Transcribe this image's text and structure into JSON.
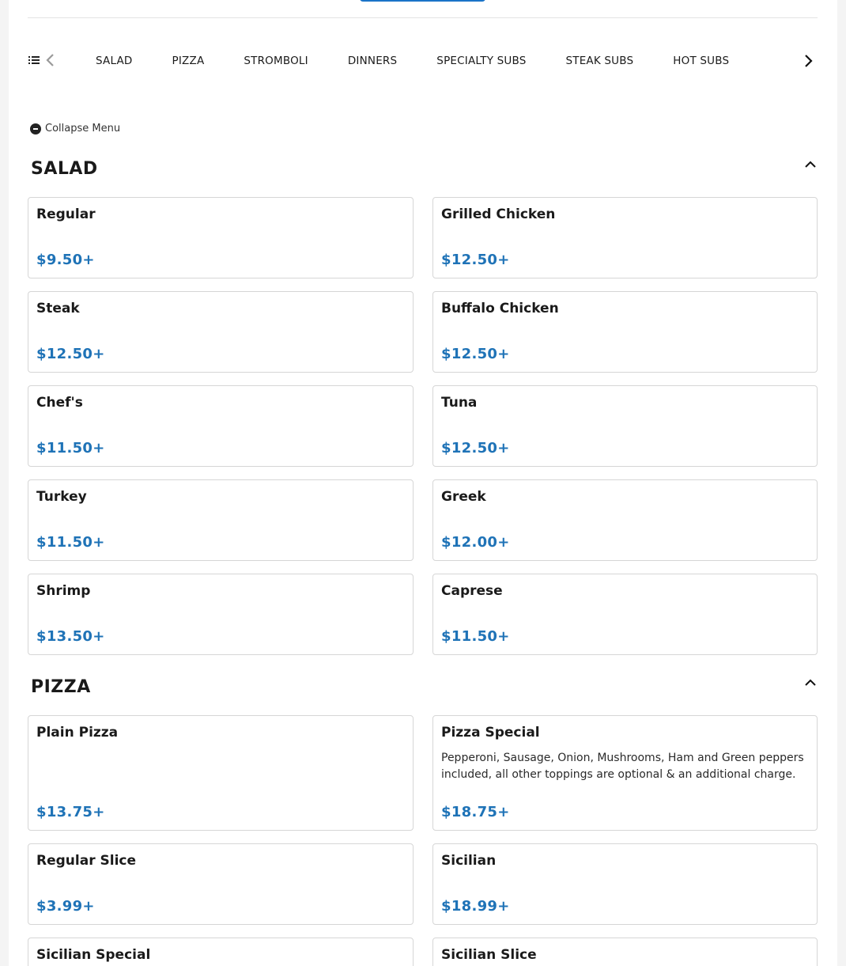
{
  "nav": {
    "categories": [
      "SALAD",
      "PIZZA",
      "STROMBOLI",
      "DINNERS",
      "SPECIALTY SUBS",
      "STEAK SUBS",
      "HOT SUBS"
    ]
  },
  "collapse_label": "Collapse Menu",
  "sections": [
    {
      "title": "SALAD",
      "items": [
        {
          "name": "Regular",
          "price": "$9.50+"
        },
        {
          "name": "Grilled Chicken",
          "price": "$12.50+"
        },
        {
          "name": "Steak",
          "price": "$12.50+"
        },
        {
          "name": "Buffalo Chicken",
          "price": "$12.50+"
        },
        {
          "name": "Chef's",
          "price": "$11.50+"
        },
        {
          "name": "Tuna",
          "price": "$12.50+"
        },
        {
          "name": "Turkey",
          "price": "$11.50+"
        },
        {
          "name": "Greek",
          "price": "$12.00+"
        },
        {
          "name": "Shrimp",
          "price": "$13.50+"
        },
        {
          "name": "Caprese",
          "price": "$11.50+"
        }
      ]
    },
    {
      "title": "PIZZA",
      "items": [
        {
          "name": "Plain Pizza",
          "price": "$13.75+"
        },
        {
          "name": "Pizza Special",
          "description": "Pepperoni, Sausage, Onion, Mushrooms, Ham and Green peppers included, all other toppings are optional & an additional charge.",
          "price": "$18.75+"
        },
        {
          "name": "Regular Slice",
          "price": "$3.99+"
        },
        {
          "name": "Sicilian",
          "price": "$18.99+"
        },
        {
          "name": "Sicilian Special"
        },
        {
          "name": "Sicilian Slice"
        }
      ]
    }
  ],
  "colors": {
    "price": "#1f73b7",
    "accent": "#1a73c8"
  },
  "icons": {
    "list": "list-icon",
    "prev": "chevron-left-icon",
    "next": "chevron-right-icon",
    "collapse": "minus-circle-icon",
    "section_toggle": "chevron-up-icon"
  }
}
